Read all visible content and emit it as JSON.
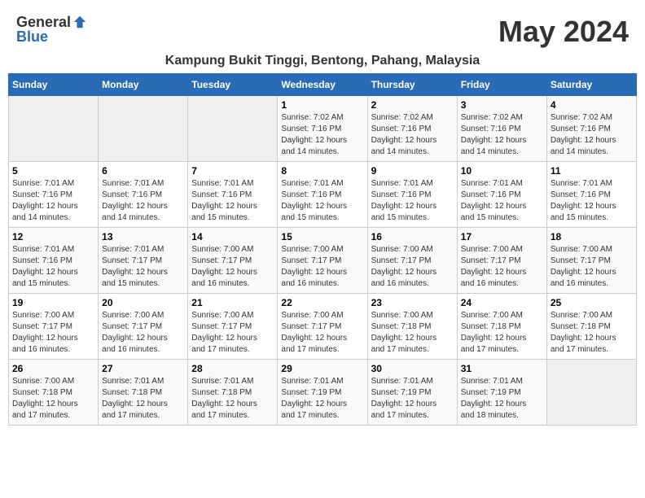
{
  "header": {
    "logo_general": "General",
    "logo_blue": "Blue",
    "month_year": "May 2024",
    "location": "Kampung Bukit Tinggi, Bentong, Pahang, Malaysia"
  },
  "weekdays": [
    "Sunday",
    "Monday",
    "Tuesday",
    "Wednesday",
    "Thursday",
    "Friday",
    "Saturday"
  ],
  "weeks": [
    [
      {
        "day": "",
        "info": ""
      },
      {
        "day": "",
        "info": ""
      },
      {
        "day": "",
        "info": ""
      },
      {
        "day": "1",
        "info": "Sunrise: 7:02 AM\nSunset: 7:16 PM\nDaylight: 12 hours\nand 14 minutes."
      },
      {
        "day": "2",
        "info": "Sunrise: 7:02 AM\nSunset: 7:16 PM\nDaylight: 12 hours\nand 14 minutes."
      },
      {
        "day": "3",
        "info": "Sunrise: 7:02 AM\nSunset: 7:16 PM\nDaylight: 12 hours\nand 14 minutes."
      },
      {
        "day": "4",
        "info": "Sunrise: 7:02 AM\nSunset: 7:16 PM\nDaylight: 12 hours\nand 14 minutes."
      }
    ],
    [
      {
        "day": "5",
        "info": "Sunrise: 7:01 AM\nSunset: 7:16 PM\nDaylight: 12 hours\nand 14 minutes."
      },
      {
        "day": "6",
        "info": "Sunrise: 7:01 AM\nSunset: 7:16 PM\nDaylight: 12 hours\nand 14 minutes."
      },
      {
        "day": "7",
        "info": "Sunrise: 7:01 AM\nSunset: 7:16 PM\nDaylight: 12 hours\nand 15 minutes."
      },
      {
        "day": "8",
        "info": "Sunrise: 7:01 AM\nSunset: 7:16 PM\nDaylight: 12 hours\nand 15 minutes."
      },
      {
        "day": "9",
        "info": "Sunrise: 7:01 AM\nSunset: 7:16 PM\nDaylight: 12 hours\nand 15 minutes."
      },
      {
        "day": "10",
        "info": "Sunrise: 7:01 AM\nSunset: 7:16 PM\nDaylight: 12 hours\nand 15 minutes."
      },
      {
        "day": "11",
        "info": "Sunrise: 7:01 AM\nSunset: 7:16 PM\nDaylight: 12 hours\nand 15 minutes."
      }
    ],
    [
      {
        "day": "12",
        "info": "Sunrise: 7:01 AM\nSunset: 7:16 PM\nDaylight: 12 hours\nand 15 minutes."
      },
      {
        "day": "13",
        "info": "Sunrise: 7:01 AM\nSunset: 7:17 PM\nDaylight: 12 hours\nand 15 minutes."
      },
      {
        "day": "14",
        "info": "Sunrise: 7:00 AM\nSunset: 7:17 PM\nDaylight: 12 hours\nand 16 minutes."
      },
      {
        "day": "15",
        "info": "Sunrise: 7:00 AM\nSunset: 7:17 PM\nDaylight: 12 hours\nand 16 minutes."
      },
      {
        "day": "16",
        "info": "Sunrise: 7:00 AM\nSunset: 7:17 PM\nDaylight: 12 hours\nand 16 minutes."
      },
      {
        "day": "17",
        "info": "Sunrise: 7:00 AM\nSunset: 7:17 PM\nDaylight: 12 hours\nand 16 minutes."
      },
      {
        "day": "18",
        "info": "Sunrise: 7:00 AM\nSunset: 7:17 PM\nDaylight: 12 hours\nand 16 minutes."
      }
    ],
    [
      {
        "day": "19",
        "info": "Sunrise: 7:00 AM\nSunset: 7:17 PM\nDaylight: 12 hours\nand 16 minutes."
      },
      {
        "day": "20",
        "info": "Sunrise: 7:00 AM\nSunset: 7:17 PM\nDaylight: 12 hours\nand 16 minutes."
      },
      {
        "day": "21",
        "info": "Sunrise: 7:00 AM\nSunset: 7:17 PM\nDaylight: 12 hours\nand 17 minutes."
      },
      {
        "day": "22",
        "info": "Sunrise: 7:00 AM\nSunset: 7:17 PM\nDaylight: 12 hours\nand 17 minutes."
      },
      {
        "day": "23",
        "info": "Sunrise: 7:00 AM\nSunset: 7:18 PM\nDaylight: 12 hours\nand 17 minutes."
      },
      {
        "day": "24",
        "info": "Sunrise: 7:00 AM\nSunset: 7:18 PM\nDaylight: 12 hours\nand 17 minutes."
      },
      {
        "day": "25",
        "info": "Sunrise: 7:00 AM\nSunset: 7:18 PM\nDaylight: 12 hours\nand 17 minutes."
      }
    ],
    [
      {
        "day": "26",
        "info": "Sunrise: 7:00 AM\nSunset: 7:18 PM\nDaylight: 12 hours\nand 17 minutes."
      },
      {
        "day": "27",
        "info": "Sunrise: 7:01 AM\nSunset: 7:18 PM\nDaylight: 12 hours\nand 17 minutes."
      },
      {
        "day": "28",
        "info": "Sunrise: 7:01 AM\nSunset: 7:18 PM\nDaylight: 12 hours\nand 17 minutes."
      },
      {
        "day": "29",
        "info": "Sunrise: 7:01 AM\nSunset: 7:19 PM\nDaylight: 12 hours\nand 17 minutes."
      },
      {
        "day": "30",
        "info": "Sunrise: 7:01 AM\nSunset: 7:19 PM\nDaylight: 12 hours\nand 17 minutes."
      },
      {
        "day": "31",
        "info": "Sunrise: 7:01 AM\nSunset: 7:19 PM\nDaylight: 12 hours\nand 18 minutes."
      },
      {
        "day": "",
        "info": ""
      }
    ]
  ]
}
